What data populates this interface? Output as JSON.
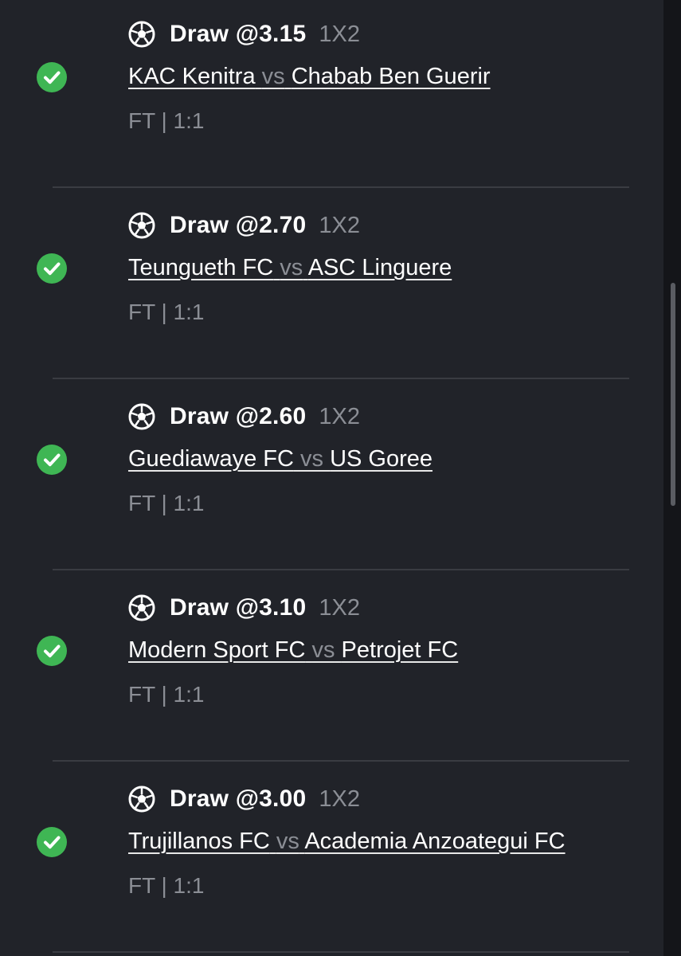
{
  "colors": {
    "success": "#3fb654",
    "background": "#212329",
    "muted_text": "#8b8e95",
    "divider": "#3a3c42"
  },
  "icons": {
    "sport": "soccer-ball-icon",
    "status": "check-circle-icon"
  },
  "bets": [
    {
      "pick": "Draw @3.15",
      "market": "1X2",
      "home": "KAC Kenitra",
      "vs": "vs",
      "away": "Chabab Ben Guerir",
      "result": "FT | 1:1",
      "status": "won"
    },
    {
      "pick": "Draw @2.70",
      "market": "1X2",
      "home": "Teungueth FC",
      "vs": "vs",
      "away": "ASC Linguere",
      "result": "FT | 1:1",
      "status": "won"
    },
    {
      "pick": "Draw @2.60",
      "market": "1X2",
      "home": "Guediawaye FC",
      "vs": "vs",
      "away": "US Goree",
      "result": "FT | 1:1",
      "status": "won"
    },
    {
      "pick": "Draw @3.10",
      "market": "1X2",
      "home": "Modern Sport FC",
      "vs": "vs",
      "away": "Petrojet FC",
      "result": "FT | 1:1",
      "status": "won"
    },
    {
      "pick": "Draw @3.00",
      "market": "1X2",
      "home": "Trujillanos FC",
      "vs": "vs",
      "away": "Academia Anzoategui FC",
      "result": "FT | 1:1",
      "status": "won"
    }
  ]
}
